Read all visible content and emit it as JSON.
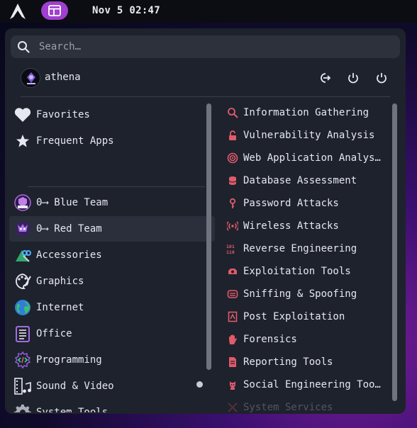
{
  "topbar": {
    "clock": "Nov 5 02:47",
    "logo_icon": "arch-logo-icon",
    "active_app_icon": "menu-layout-icon",
    "accent": "#a03fd0"
  },
  "search": {
    "placeholder": "Search…",
    "value": ""
  },
  "user": {
    "name": "athena",
    "avatar_icon": "athena-avatar-icon",
    "actions": [
      "logout-icon",
      "restart-icon",
      "power-icon"
    ]
  },
  "categories": [
    {
      "label": "Favorites",
      "icon": "heart-icon"
    },
    {
      "label": "Frequent Apps",
      "icon": "star-icon"
    },
    {
      "label": "0⟶ Blue Team",
      "icon": "blue-team-icon"
    },
    {
      "label": "0⟶ Red Team",
      "icon": "red-team-icon",
      "selected": true
    },
    {
      "label": "Accessories",
      "icon": "accessories-icon"
    },
    {
      "label": "Graphics",
      "icon": "graphics-icon"
    },
    {
      "label": "Internet",
      "icon": "globe-icon"
    },
    {
      "label": "Office",
      "icon": "office-icon"
    },
    {
      "label": "Programming",
      "icon": "programming-icon"
    },
    {
      "label": "Sound & Video",
      "icon": "sound-video-icon"
    },
    {
      "label": "System Tools",
      "icon": "gear-icon"
    }
  ],
  "apps": [
    {
      "label": "Information Gathering",
      "icon": "magnifier-icon"
    },
    {
      "label": "Vulnerability Analysis",
      "icon": "unlocked-icon"
    },
    {
      "label": "Web Application Analys…",
      "icon": "web-target-icon"
    },
    {
      "label": "Database Assessment",
      "icon": "database-icon"
    },
    {
      "label": "Password Attacks",
      "icon": "key-icon"
    },
    {
      "label": "Wireless Attacks",
      "icon": "wireless-icon"
    },
    {
      "label": "Reverse Engineering",
      "icon": "binary-icon"
    },
    {
      "label": "Exploitation Tools",
      "icon": "exploit-icon"
    },
    {
      "label": "Sniffing & Spoofing",
      "icon": "sniff-icon"
    },
    {
      "label": "Post Exploitation",
      "icon": "post-exploit-icon"
    },
    {
      "label": "Forensics",
      "icon": "hand-icon"
    },
    {
      "label": "Reporting Tools",
      "icon": "report-icon"
    },
    {
      "label": "Social Engineering Too…",
      "icon": "social-eng-icon"
    },
    {
      "label": "System Services",
      "icon": "services-icon"
    }
  ]
}
